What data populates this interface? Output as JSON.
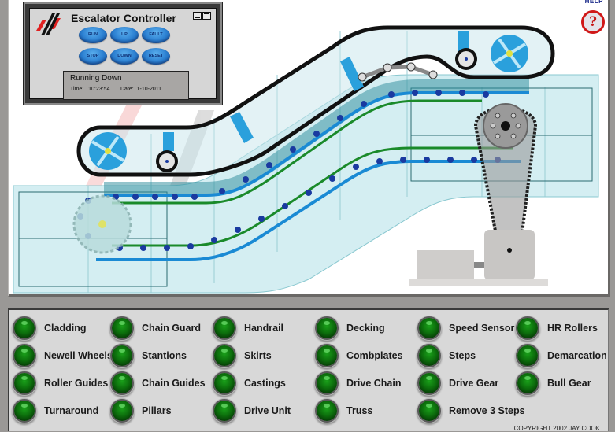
{
  "help": {
    "label": "HELP",
    "icon": "help-question-icon",
    "glyph": "?"
  },
  "controller": {
    "title": "Escalator  Controller",
    "buttons": [
      {
        "label": "RUN"
      },
      {
        "label": "UP"
      },
      {
        "label": "FAULT"
      },
      {
        "label": "STOP"
      },
      {
        "label": "DOWN"
      },
      {
        "label": "RESET"
      }
    ],
    "status": {
      "message": "Running Down",
      "time_label": "Time:",
      "time": "10:23:54",
      "date_label": "Date:",
      "date": "1-10-2011"
    }
  },
  "components": {
    "columns": [
      [
        "Cladding",
        "Newell Wheels",
        "Roller Guides",
        "Turnaround"
      ],
      [
        "Chain Guard",
        "Stantions",
        "Chain Guides",
        "Pillars"
      ],
      [
        "Handrail",
        "Skirts",
        "Castings",
        "Drive Unit"
      ],
      [
        "Decking",
        "Combplates",
        "Drive Chain",
        "Truss"
      ],
      [
        "Speed Sensor",
        "Steps",
        "Drive Gear",
        "Remove 3 Steps"
      ],
      [
        "HR Rollers",
        "Demarcation",
        "Bull Gear"
      ]
    ],
    "lamp_color": "#0c7a0c"
  },
  "copyright": "COPYRIGHT  2002 JAY COOK",
  "colors": {
    "handrail": "#000000",
    "truss_fill": "#d4eef2",
    "step_chain": "#1a8ad4",
    "chain_dots": "#1a3aa0",
    "guide_rail": "#1a8a2a",
    "drive_chain": "#333333"
  }
}
